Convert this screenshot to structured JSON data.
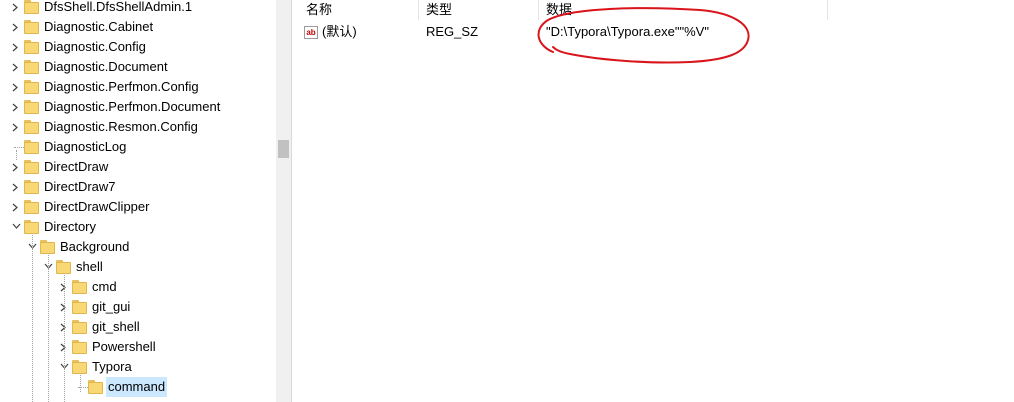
{
  "tree": {
    "items": [
      {
        "label": "DfsShell.DfsShellAdmin.1",
        "level": 0,
        "expander": "collapsed"
      },
      {
        "label": "Diagnostic.Cabinet",
        "level": 0,
        "expander": "collapsed"
      },
      {
        "label": "Diagnostic.Config",
        "level": 0,
        "expander": "collapsed"
      },
      {
        "label": "Diagnostic.Document",
        "level": 0,
        "expander": "collapsed"
      },
      {
        "label": "Diagnostic.Perfmon.Config",
        "level": 0,
        "expander": "collapsed"
      },
      {
        "label": "Diagnostic.Perfmon.Document",
        "level": 0,
        "expander": "collapsed"
      },
      {
        "label": "Diagnostic.Resmon.Config",
        "level": 0,
        "expander": "collapsed"
      },
      {
        "label": "DiagnosticLog",
        "level": 0,
        "expander": "none"
      },
      {
        "label": "DirectDraw",
        "level": 0,
        "expander": "collapsed"
      },
      {
        "label": "DirectDraw7",
        "level": 0,
        "expander": "collapsed"
      },
      {
        "label": "DirectDrawClipper",
        "level": 0,
        "expander": "collapsed"
      },
      {
        "label": "Directory",
        "level": 0,
        "expander": "expanded"
      },
      {
        "label": "Background",
        "level": 1,
        "expander": "expanded"
      },
      {
        "label": "shell",
        "level": 2,
        "expander": "expanded"
      },
      {
        "label": "cmd",
        "level": 3,
        "expander": "collapsed"
      },
      {
        "label": "git_gui",
        "level": 3,
        "expander": "collapsed"
      },
      {
        "label": "git_shell",
        "level": 3,
        "expander": "collapsed"
      },
      {
        "label": "Powershell",
        "level": 3,
        "expander": "collapsed"
      },
      {
        "label": "Typora",
        "level": 3,
        "expander": "expanded"
      },
      {
        "label": "command",
        "level": 4,
        "expander": "none",
        "selected": true
      }
    ]
  },
  "list": {
    "columns": [
      "名称",
      "类型",
      "数据"
    ],
    "rows": [
      {
        "icon": "string-value-icon",
        "name": "(默认)",
        "type": "REG_SZ",
        "data": "\"D:\\Typora\\Typora.exe\"\"%V\""
      }
    ]
  },
  "annotation": {
    "color": "#d9141b",
    "shape": "hand-drawn-ellipse"
  }
}
